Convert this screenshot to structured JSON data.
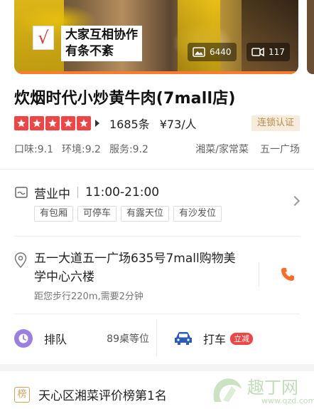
{
  "hero": {
    "caption_line1": "大家互相协作",
    "caption_line2": "有条不紊",
    "logo_glyph": "√",
    "photo_count": "6440",
    "video_count": "117"
  },
  "shop": {
    "name": "炊烟时代小炒黄牛肉(7mall店)",
    "rating_stars": 5,
    "reviews": "1685条",
    "price": "¥73/人",
    "chain_badge": "连锁认证",
    "scores": [
      "口味:9.1",
      "环境:9.2",
      "服务:9.2"
    ],
    "cuisine": "湘菜/家常菜",
    "area": "五一广场"
  },
  "hours": {
    "status": "营业中",
    "time": "11:00-21:00",
    "tags": [
      "有包厢",
      "可停车",
      "有露天位",
      "有沙发位"
    ]
  },
  "address": {
    "text": "五一大道五一广场635号7mall购物美学中心六楼",
    "distance": "距您步行220m,需要2分钟"
  },
  "queue": {
    "label": "排队",
    "count": "89桌等位"
  },
  "taxi": {
    "label": "打车",
    "badge": "立减"
  },
  "ranking": {
    "badge": "榜",
    "text": "天心区湘菜评价榜第1名"
  },
  "watermark": {
    "name": "趣丁网",
    "url": "www.qzd.com"
  },
  "colors": {
    "star_red": "#f04545",
    "phone_orange": "#ff6a2a",
    "queue_purple": "#9b7fe0",
    "taxi_blue": "#2a5cb8",
    "chain_gold": "#b88a4a"
  }
}
